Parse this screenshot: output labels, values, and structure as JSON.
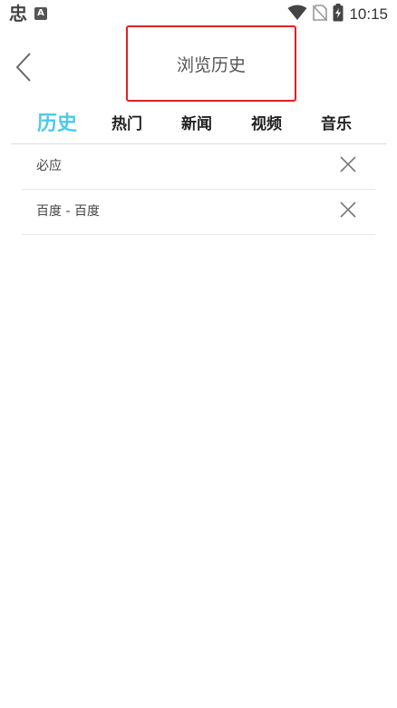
{
  "status_bar": {
    "app_glyph": "忠",
    "notification_badge": "A",
    "time": "10:15",
    "icons": [
      "wifi-icon",
      "no-sim-icon",
      "battery-charging-icon"
    ]
  },
  "header": {
    "back_icon": "chevron-left-icon",
    "title": "浏览历史"
  },
  "tabs": [
    {
      "label": "历史",
      "active": true
    },
    {
      "label": "热门",
      "active": false
    },
    {
      "label": "新闻",
      "active": false
    },
    {
      "label": "视频",
      "active": false
    },
    {
      "label": "音乐",
      "active": false
    }
  ],
  "history": [
    {
      "label": "必应"
    },
    {
      "label": "百度 - 百度"
    }
  ],
  "colors": {
    "active_tab": "#4fc9ea",
    "highlight_border": "#e02020"
  }
}
